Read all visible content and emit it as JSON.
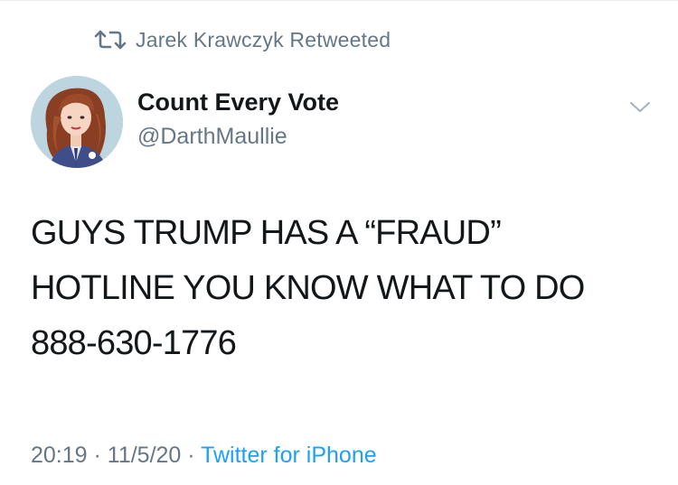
{
  "retweet": {
    "icon": "retweet-icon",
    "label": "Jarek Krawczyk Retweeted"
  },
  "author": {
    "avatar": "avatar-illustration",
    "display_name": "Count Every Vote",
    "handle": "@DarthMaullie"
  },
  "menu": {
    "icon": "chevron-down-icon"
  },
  "tweet": {
    "text": "GUYS TRUMP HAS A “FRAUD”\nHOTLINE YOU KNOW WHAT TO DO\n888-630-1776"
  },
  "meta": {
    "time": "20:19",
    "separator": " · ",
    "date": "11/5/20",
    "source": "Twitter for iPhone"
  },
  "colors": {
    "text_primary": "#14171a",
    "text_secondary": "#657786",
    "link": "#1da1f2"
  }
}
